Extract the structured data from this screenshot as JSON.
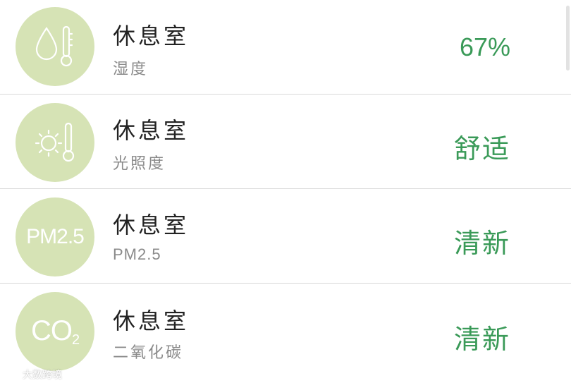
{
  "rows": [
    {
      "icon": "humidity-thermometer-icon",
      "title": "休息室",
      "subtitle": "湿度",
      "value": "67%"
    },
    {
      "icon": "sun-thermometer-icon",
      "title": "休息室",
      "subtitle": "光照度",
      "value": "舒适"
    },
    {
      "icon": "pm25-icon",
      "icon_text": "PM2.5",
      "title": "休息室",
      "subtitle": "PM2.5",
      "value": "清新"
    },
    {
      "icon": "co2-icon",
      "icon_text_main": "CO",
      "icon_text_sub": "2",
      "title": "休息室",
      "subtitle": "二氧化碳",
      "value": "清新"
    }
  ],
  "watermark": {
    "text": "大数跨境"
  },
  "colors": {
    "circle_bg": "#d6e3b5",
    "value_text": "#3a9a58",
    "title_text": "#222222",
    "subtitle_text": "#8a8a8a",
    "divider": "#d9d9d9"
  }
}
